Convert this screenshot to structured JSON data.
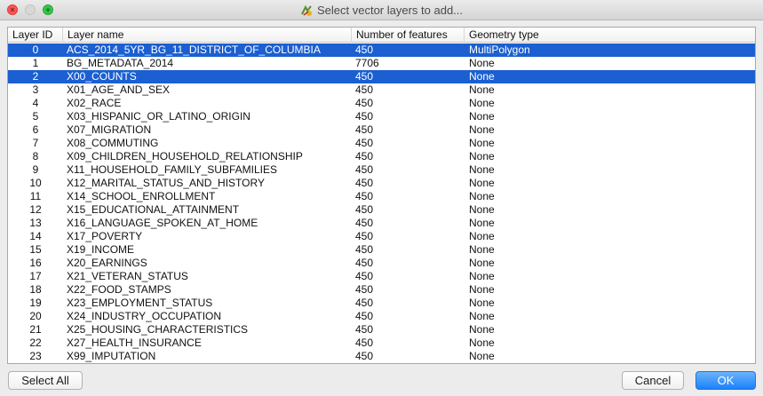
{
  "window": {
    "title": "Select vector layers to add...",
    "app_icon": "qgis-icon"
  },
  "table": {
    "columns": [
      "Layer ID",
      "Layer name",
      "Number of features",
      "Geometry type"
    ],
    "rows": [
      {
        "id": "0",
        "name": "ACS_2014_5YR_BG_11_DISTRICT_OF_COLUMBIA",
        "features": "450",
        "geometry": "MultiPolygon",
        "selected": true
      },
      {
        "id": "1",
        "name": "BG_METADATA_2014",
        "features": "7706",
        "geometry": "None",
        "selected": false
      },
      {
        "id": "2",
        "name": "X00_COUNTS",
        "features": "450",
        "geometry": "None",
        "selected": true
      },
      {
        "id": "3",
        "name": "X01_AGE_AND_SEX",
        "features": "450",
        "geometry": "None",
        "selected": false
      },
      {
        "id": "4",
        "name": "X02_RACE",
        "features": "450",
        "geometry": "None",
        "selected": false
      },
      {
        "id": "5",
        "name": "X03_HISPANIC_OR_LATINO_ORIGIN",
        "features": "450",
        "geometry": "None",
        "selected": false
      },
      {
        "id": "6",
        "name": "X07_MIGRATION",
        "features": "450",
        "geometry": "None",
        "selected": false
      },
      {
        "id": "7",
        "name": "X08_COMMUTING",
        "features": "450",
        "geometry": "None",
        "selected": false
      },
      {
        "id": "8",
        "name": "X09_CHILDREN_HOUSEHOLD_RELATIONSHIP",
        "features": "450",
        "geometry": "None",
        "selected": false
      },
      {
        "id": "9",
        "name": "X11_HOUSEHOLD_FAMILY_SUBFAMILIES",
        "features": "450",
        "geometry": "None",
        "selected": false
      },
      {
        "id": "10",
        "name": "X12_MARITAL_STATUS_AND_HISTORY",
        "features": "450",
        "geometry": "None",
        "selected": false
      },
      {
        "id": "11",
        "name": "X14_SCHOOL_ENROLLMENT",
        "features": "450",
        "geometry": "None",
        "selected": false
      },
      {
        "id": "12",
        "name": "X15_EDUCATIONAL_ATTAINMENT",
        "features": "450",
        "geometry": "None",
        "selected": false
      },
      {
        "id": "13",
        "name": "X16_LANGUAGE_SPOKEN_AT_HOME",
        "features": "450",
        "geometry": "None",
        "selected": false
      },
      {
        "id": "14",
        "name": "X17_POVERTY",
        "features": "450",
        "geometry": "None",
        "selected": false
      },
      {
        "id": "15",
        "name": "X19_INCOME",
        "features": "450",
        "geometry": "None",
        "selected": false
      },
      {
        "id": "16",
        "name": "X20_EARNINGS",
        "features": "450",
        "geometry": "None",
        "selected": false
      },
      {
        "id": "17",
        "name": "X21_VETERAN_STATUS",
        "features": "450",
        "geometry": "None",
        "selected": false
      },
      {
        "id": "18",
        "name": "X22_FOOD_STAMPS",
        "features": "450",
        "geometry": "None",
        "selected": false
      },
      {
        "id": "19",
        "name": "X23_EMPLOYMENT_STATUS",
        "features": "450",
        "geometry": "None",
        "selected": false
      },
      {
        "id": "20",
        "name": "X24_INDUSTRY_OCCUPATION",
        "features": "450",
        "geometry": "None",
        "selected": false
      },
      {
        "id": "21",
        "name": "X25_HOUSING_CHARACTERISTICS",
        "features": "450",
        "geometry": "None",
        "selected": false
      },
      {
        "id": "22",
        "name": "X27_HEALTH_INSURANCE",
        "features": "450",
        "geometry": "None",
        "selected": false
      },
      {
        "id": "23",
        "name": "X99_IMPUTATION",
        "features": "450",
        "geometry": "None",
        "selected": false
      }
    ]
  },
  "buttons": {
    "select_all": "Select All",
    "cancel": "Cancel",
    "ok": "OK"
  },
  "colors": {
    "selection": "#1b5fd1",
    "ok_button": "#1a82fb",
    "close": "#fc5753",
    "zoom": "#33c748"
  }
}
